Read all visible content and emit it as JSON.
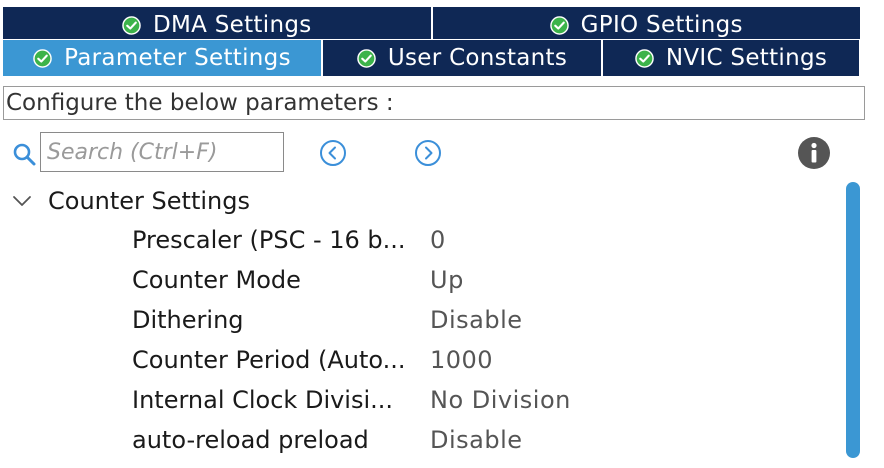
{
  "tabs": {
    "row1": [
      {
        "label": "DMA Settings",
        "icon": "check-circle-icon"
      },
      {
        "label": "GPIO Settings",
        "icon": "check-circle-icon"
      }
    ],
    "row2": [
      {
        "label": "Parameter Settings",
        "icon": "check-circle-icon",
        "active": true
      },
      {
        "label": "User Constants",
        "icon": "check-circle-icon"
      },
      {
        "label": "NVIC Settings",
        "icon": "check-circle-icon"
      }
    ]
  },
  "config_label": "Configure the below parameters :",
  "search": {
    "placeholder": "Search (Ctrl+F)",
    "value": ""
  },
  "group": {
    "title": "Counter Settings",
    "expanded": true,
    "params": [
      {
        "name": "Prescaler (PSC - 16 b...",
        "value": "0"
      },
      {
        "name": "Counter Mode",
        "value": "Up"
      },
      {
        "name": "Dithering",
        "value": "Disable"
      },
      {
        "name": "Counter Period (Auto...",
        "value": "1000"
      },
      {
        "name": "Internal Clock Divisi...",
        "value": "No Division"
      },
      {
        "name": "auto-reload preload",
        "value": "Disable"
      }
    ]
  },
  "colors": {
    "tab_dark": "#0f2855",
    "tab_active": "#3b97d3",
    "check_green": "#3cb34a",
    "scroll_accent": "#3b97d3"
  }
}
